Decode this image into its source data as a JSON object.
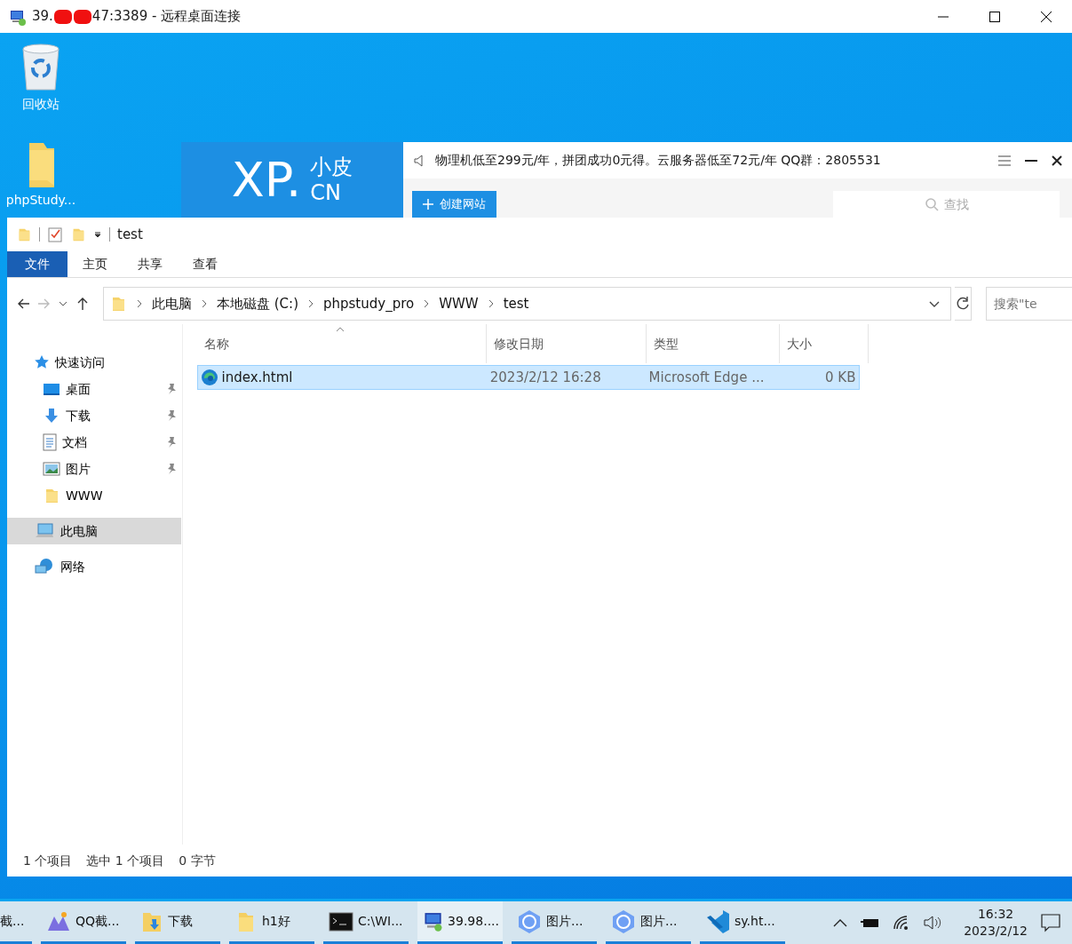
{
  "window": {
    "title_start": "39.",
    "title_end": "47:3389 - 远程桌面连接"
  },
  "desktop_icons": [
    {
      "label": "回收站",
      "kind": "recycle"
    },
    {
      "label": "phpStudy...",
      "kind": "folder"
    }
  ],
  "phpstudy": {
    "logo_main": "XP.",
    "logo_top": "小皮",
    "logo_bottom": "CN",
    "notice": "物理机低至299元/年，拼团成功0元得。云服务器低至72元/年  QQ群：2805531",
    "create_button": "创建网站",
    "search_placeholder": "查找"
  },
  "explorer": {
    "title": "test",
    "ribbon_tabs": [
      {
        "label": "文件",
        "selected": true
      },
      {
        "label": "主页",
        "selected": false
      },
      {
        "label": "共享",
        "selected": false
      },
      {
        "label": "查看",
        "selected": false
      }
    ],
    "breadcrumb": [
      "此电脑",
      "本地磁盘 (C:)",
      "phpstudy_pro",
      "WWW",
      "test"
    ],
    "search_placeholder": "搜索\"te",
    "nav": [
      {
        "label": "快速访问",
        "kind": "star",
        "selected": false,
        "children": [
          {
            "label": "桌面",
            "kind": "desktop",
            "pinned": true,
            "selected": false
          },
          {
            "label": "下载",
            "kind": "download",
            "pinned": true,
            "selected": false
          },
          {
            "label": "文档",
            "kind": "document",
            "pinned": true,
            "selected": false
          },
          {
            "label": "图片",
            "kind": "picture",
            "pinned": true,
            "selected": false
          },
          {
            "label": "WWW",
            "kind": "folder",
            "pinned": false,
            "selected": false
          }
        ]
      },
      {
        "label": "此电脑",
        "kind": "computer",
        "selected": true
      },
      {
        "label": "网络",
        "kind": "network",
        "selected": false
      }
    ],
    "columns": [
      "名称",
      "修改日期",
      "类型",
      "大小"
    ],
    "files": [
      {
        "name": "index.html",
        "modified": "2023/2/12 16:28",
        "type": "Microsoft Edge ...",
        "size": "0 KB",
        "selected": true
      }
    ],
    "status": [
      "1 个项目",
      "选中 1 个项目",
      "0 字节"
    ]
  },
  "taskbar": {
    "items": [
      {
        "label": "截...",
        "kind": "blank",
        "selected": false
      },
      {
        "label": "QQ截...",
        "kind": "qq",
        "selected": false
      },
      {
        "label": "下载",
        "kind": "download",
        "selected": false
      },
      {
        "label": "h1好",
        "kind": "folder",
        "selected": false
      },
      {
        "label": "C:\\WI...",
        "kind": "console",
        "selected": false
      },
      {
        "label": "39.98....",
        "kind": "remote",
        "selected": true
      },
      {
        "label": "图片...",
        "kind": "hex",
        "selected": false
      },
      {
        "label": "图片...",
        "kind": "hex",
        "selected": false
      },
      {
        "label": "sy.ht...",
        "kind": "code",
        "selected": false
      }
    ],
    "time": "16:32",
    "date": "2023/2/12"
  }
}
